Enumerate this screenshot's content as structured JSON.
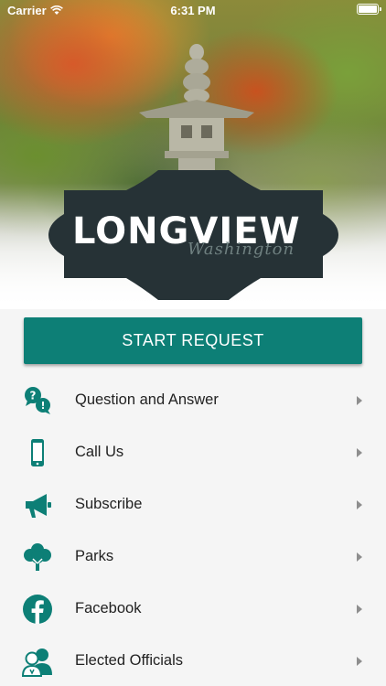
{
  "status_bar": {
    "carrier": "Carrier",
    "time": "6:31 PM"
  },
  "logo": {
    "title": "LONGVIEW",
    "script": "Washington"
  },
  "start_request": {
    "label": "START REQUEST"
  },
  "menu": {
    "items": [
      {
        "label": "Question and Answer",
        "icon": "question-answer-icon"
      },
      {
        "label": "Call Us",
        "icon": "phone-icon"
      },
      {
        "label": "Subscribe",
        "icon": "megaphone-icon"
      },
      {
        "label": "Parks",
        "icon": "tree-icon"
      },
      {
        "label": "Facebook",
        "icon": "facebook-icon"
      },
      {
        "label": "Elected Officials",
        "icon": "officials-icon"
      }
    ]
  },
  "colors": {
    "accent": "#0d7f76",
    "logo_badge": "#263236"
  }
}
